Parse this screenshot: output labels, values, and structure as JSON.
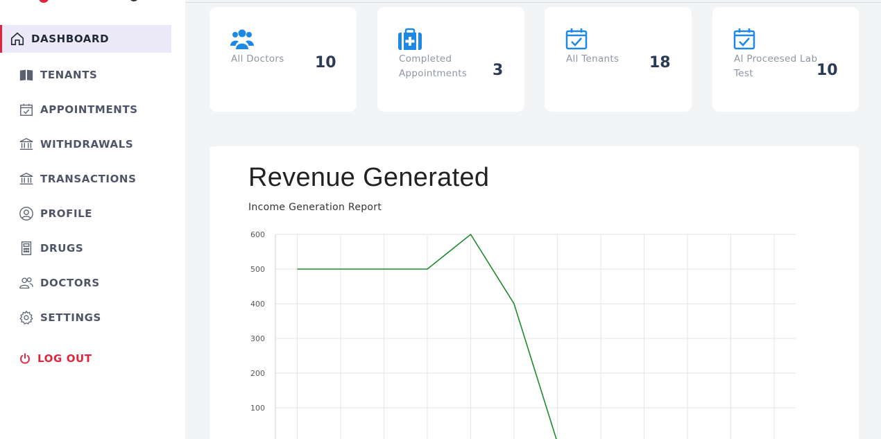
{
  "sidebar": {
    "items": [
      {
        "label": "DASHBOARD",
        "icon": "home-icon"
      },
      {
        "label": "TENANTS",
        "icon": "book-icon"
      },
      {
        "label": "APPOINTMENTS",
        "icon": "calendar-check-icon"
      },
      {
        "label": "WITHDRAWALS",
        "icon": "bank-icon"
      },
      {
        "label": "TRANSACTIONS",
        "icon": "bank-icon"
      },
      {
        "label": "PROFILE",
        "icon": "user-circle-icon"
      },
      {
        "label": "DRUGS",
        "icon": "calculator-icon"
      },
      {
        "label": "DOCTORS",
        "icon": "users-icon"
      },
      {
        "label": "SETTINGS",
        "icon": "gear-icon"
      }
    ],
    "logout": {
      "label": "LOG OUT",
      "icon": "power-icon"
    }
  },
  "cards": [
    {
      "label": "All Doctors",
      "value": "10",
      "icon": "users-icon"
    },
    {
      "label": "Completed Appointments",
      "value": "3",
      "icon": "medical-kit-icon"
    },
    {
      "label": "All Tenants",
      "value": "18",
      "icon": "calendar-check-icon"
    },
    {
      "label": "AI Proceesed Lab Test",
      "value": "10",
      "icon": "calendar-check-icon"
    }
  ],
  "colors": {
    "accent": "#e0263e",
    "icon_blue": "#1e88e5",
    "line_green": "#1b8a2e",
    "active_bg": "#ece9f9"
  },
  "chart": {
    "title": "Revenue Generated",
    "subtitle": "Income Generation Report"
  },
  "chart_data": {
    "type": "line",
    "title": "Revenue Generated",
    "subtitle": "Income Generation Report",
    "ylim": [
      0,
      600
    ],
    "y_ticks": [
      100,
      200,
      300,
      400,
      500,
      600
    ],
    "grid": true,
    "series": [
      {
        "values": [
          500,
          500,
          500,
          500,
          600,
          400,
          0
        ]
      }
    ],
    "x_count": 12
  }
}
